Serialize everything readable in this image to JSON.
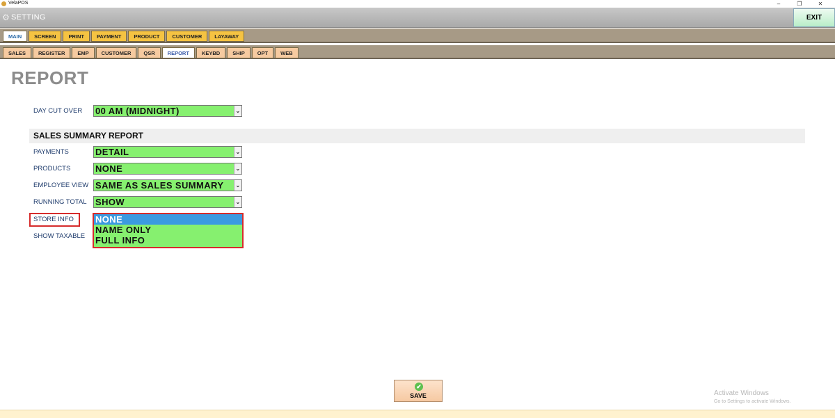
{
  "window": {
    "app_title": "VelaPOS",
    "controls": [
      "–",
      "❐",
      "✕"
    ]
  },
  "header": {
    "title": "SETTING",
    "exit_label": "EXIT"
  },
  "tabs_main": [
    {
      "label": "MAIN",
      "active": true
    },
    {
      "label": "SCREEN",
      "active": false
    },
    {
      "label": "PRINT",
      "active": false
    },
    {
      "label": "PAYMENT",
      "active": false
    },
    {
      "label": "PRODUCT",
      "active": false
    },
    {
      "label": "CUSTOMER",
      "active": false
    },
    {
      "label": "LAYAWAY",
      "active": false
    }
  ],
  "tabs_sub": [
    {
      "label": "SALES",
      "active": false
    },
    {
      "label": "REGISTER",
      "active": false
    },
    {
      "label": "EMP",
      "active": false
    },
    {
      "label": "CUSTOMER",
      "active": false
    },
    {
      "label": "QSR",
      "active": false
    },
    {
      "label": "REPORT",
      "active": true
    },
    {
      "label": "KEYBD",
      "active": false
    },
    {
      "label": "SHIP",
      "active": false
    },
    {
      "label": "OPT",
      "active": false
    },
    {
      "label": "WEB",
      "active": false
    }
  ],
  "page": {
    "title": "REPORT",
    "day_cut_over": {
      "label": "DAY CUT OVER",
      "value": "00 AM (MIDNIGHT)"
    },
    "section_title": "SALES SUMMARY REPORT",
    "fields": {
      "payments": {
        "label": "PAYMENTS",
        "value": "DETAIL"
      },
      "products": {
        "label": "PRODUCTS",
        "value": "NONE"
      },
      "employee_view": {
        "label": "EMPLOYEE VIEW",
        "value": "SAME AS SALES SUMMARY"
      },
      "running_total": {
        "label": "RUNNING TOTAL",
        "value": "SHOW"
      },
      "store_info": {
        "label": "STORE INFO"
      },
      "show_taxable": {
        "label": "SHOW TAXABLE"
      }
    },
    "store_info_options": [
      "NONE",
      "NAME ONLY",
      "FULL INFO"
    ],
    "store_info_selected": "NONE",
    "caret": "⌄"
  },
  "footer": {
    "save_label": "SAVE",
    "check_glyph": "✔"
  },
  "watermark": {
    "line1": "Activate Windows",
    "line2": "Go to Settings to activate Windows."
  },
  "colors": {
    "select_bg": "#86f06f",
    "highlight_border": "#d62b2b",
    "selected_option_bg": "#3b9ae0"
  }
}
